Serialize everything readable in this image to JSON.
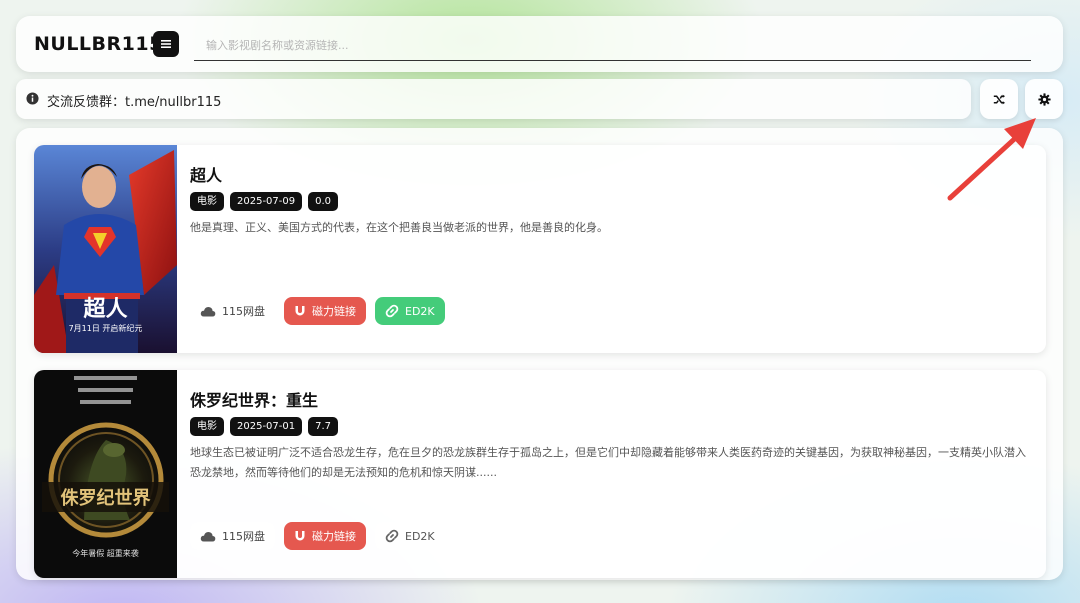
{
  "header": {
    "logo": "NULLBR115",
    "search_placeholder": "输入影视剧名称或资源链接..."
  },
  "notice": {
    "text": "交流反馈群：t.me/nullbr115"
  },
  "toolbar": {
    "shuffle_icon": "shuffle-icon",
    "settings_icon": "gear-icon"
  },
  "results": [
    {
      "title": "超人",
      "type": "电影",
      "date": "2025-07-09",
      "rating": "0.0",
      "description": "他是真理、正义、美国方式的代表，在这个把善良当做老派的世界，他是善良的化身。",
      "cloud_label": "115网盘",
      "magnet_label": "磁力链接",
      "ed2k_label": "ED2K",
      "ed2k_available": true,
      "poster_text": [
        "超人",
        "7月11日 开启新纪元"
      ]
    },
    {
      "title": "侏罗纪世界：重生",
      "type": "电影",
      "date": "2025-07-01",
      "rating": "7.7",
      "description": "地球生态已被证明广泛不适合恐龙生存，危在旦夕的恐龙族群生存于孤岛之上，但是它们中却隐藏着能够带来人类医药奇迹的关键基因，为获取神秘基因，一支精英小队潜入恐龙禁地，然而等待他们的却是无法预知的危机和惊天阴谋......",
      "cloud_label": "115网盘",
      "magnet_label": "磁力链接",
      "ed2k_label": "ED2K",
      "ed2k_available": false,
      "poster_text": [
        "侏罗纪世界",
        "今年暑假 超重来袭"
      ]
    }
  ],
  "colors": {
    "magnet": "#e5584f",
    "ed2k_active": "#44cc7a",
    "tag_bg": "#111111",
    "arrow": "#e8403a"
  }
}
